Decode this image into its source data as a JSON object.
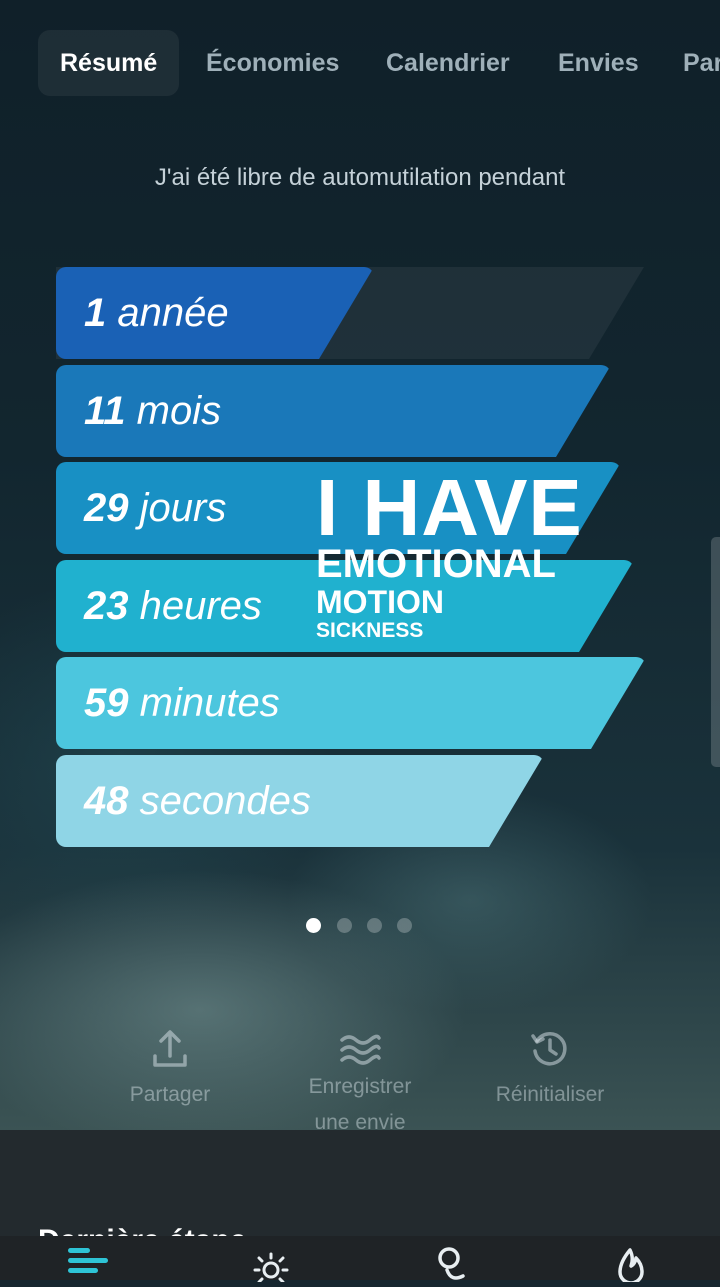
{
  "tabs": [
    {
      "label": "Résumé",
      "active": true
    },
    {
      "label": "Économies",
      "active": false
    },
    {
      "label": "Calendrier",
      "active": false
    },
    {
      "label": "Envies",
      "active": false
    },
    {
      "label": "Par",
      "active": false
    }
  ],
  "subtitle": "J'ai été libre de automutilation pendant",
  "counters": [
    {
      "value": "1",
      "unit": "année",
      "color": "#1a61b5"
    },
    {
      "value": "11",
      "unit": "mois",
      "color": "#1a78b9"
    },
    {
      "value": "29",
      "unit": "jours",
      "color": "#1890c4"
    },
    {
      "value": "23",
      "unit": "heures",
      "color": "#20b1cf"
    },
    {
      "value": "59",
      "unit": "minutes",
      "color": "#4cc6de"
    },
    {
      "value": "48",
      "unit": "secondes",
      "color": "#8fd5e6"
    }
  ],
  "overlay": {
    "line1": "I HAVE",
    "line2": "EMOTIONAL",
    "line3": "MOTION",
    "line4": "SICKNESS"
  },
  "pager": {
    "count": 4,
    "active": 1
  },
  "actions": [
    {
      "label": "Partager",
      "icon": "share-icon"
    },
    {
      "label": "Enregistrer une envie",
      "icon": "waves-icon"
    },
    {
      "label": "Réinitialiser",
      "icon": "history-icon"
    }
  ],
  "sheet": {
    "title": "Dernière étape"
  },
  "bottom_nav": [
    {
      "icon": "summary-icon",
      "active": true
    },
    {
      "icon": "sun-icon",
      "active": false
    },
    {
      "icon": "community-icon",
      "active": false
    },
    {
      "icon": "flame-icon",
      "active": false
    }
  ],
  "colors": {
    "accent": "#2ec4d6"
  }
}
